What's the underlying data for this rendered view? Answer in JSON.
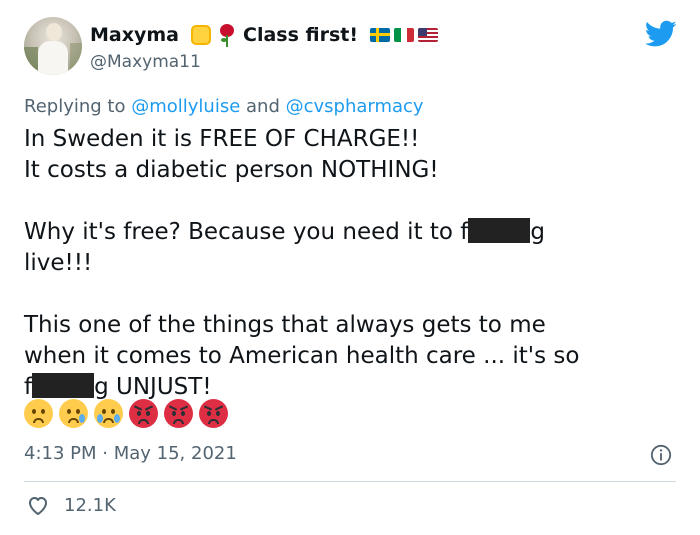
{
  "author": {
    "display_name": "Maxyma",
    "display_name_suffix": "Class first!",
    "handle": "@Maxyma11"
  },
  "icons": {
    "name_emojis": [
      "raised-fist-emoji",
      "rose-emoji"
    ],
    "flags": [
      "sweden-flag",
      "italy-flag",
      "usa-flag"
    ],
    "brand": "twitter-bird-icon",
    "info": "info-icon",
    "like": "heart-icon"
  },
  "colors": {
    "accent": "#1d9bf0",
    "text": "#0f1419",
    "muted": "#536471",
    "divider": "#cfd9de"
  },
  "reply": {
    "prefix": "Replying to ",
    "mention_1": "@mollyluise",
    "joiner": " and ",
    "mention_2": "@cvspharmacy"
  },
  "tweet": {
    "line_1": "In Sweden it is FREE OF CHARGE!!",
    "line_2": "It costs a diabetic person NOTHING!",
    "line_3a": "Why it's free? Because you need it to f",
    "line_3b": "g",
    "line_4": "live!!!",
    "line_5": "This one of the things that always gets to me",
    "line_6": "when it comes to American health care ... it's so",
    "line_7a": "f",
    "line_7b": "g UNJUST!",
    "emojis": [
      "worried-face",
      "sad-relieved-face",
      "crying-face",
      "angry-face",
      "angry-face",
      "angry-face"
    ]
  },
  "meta": {
    "time": "4:13 PM",
    "separator": " · ",
    "date": "May 15, 2021"
  },
  "stats": {
    "likes": "12.1K"
  }
}
